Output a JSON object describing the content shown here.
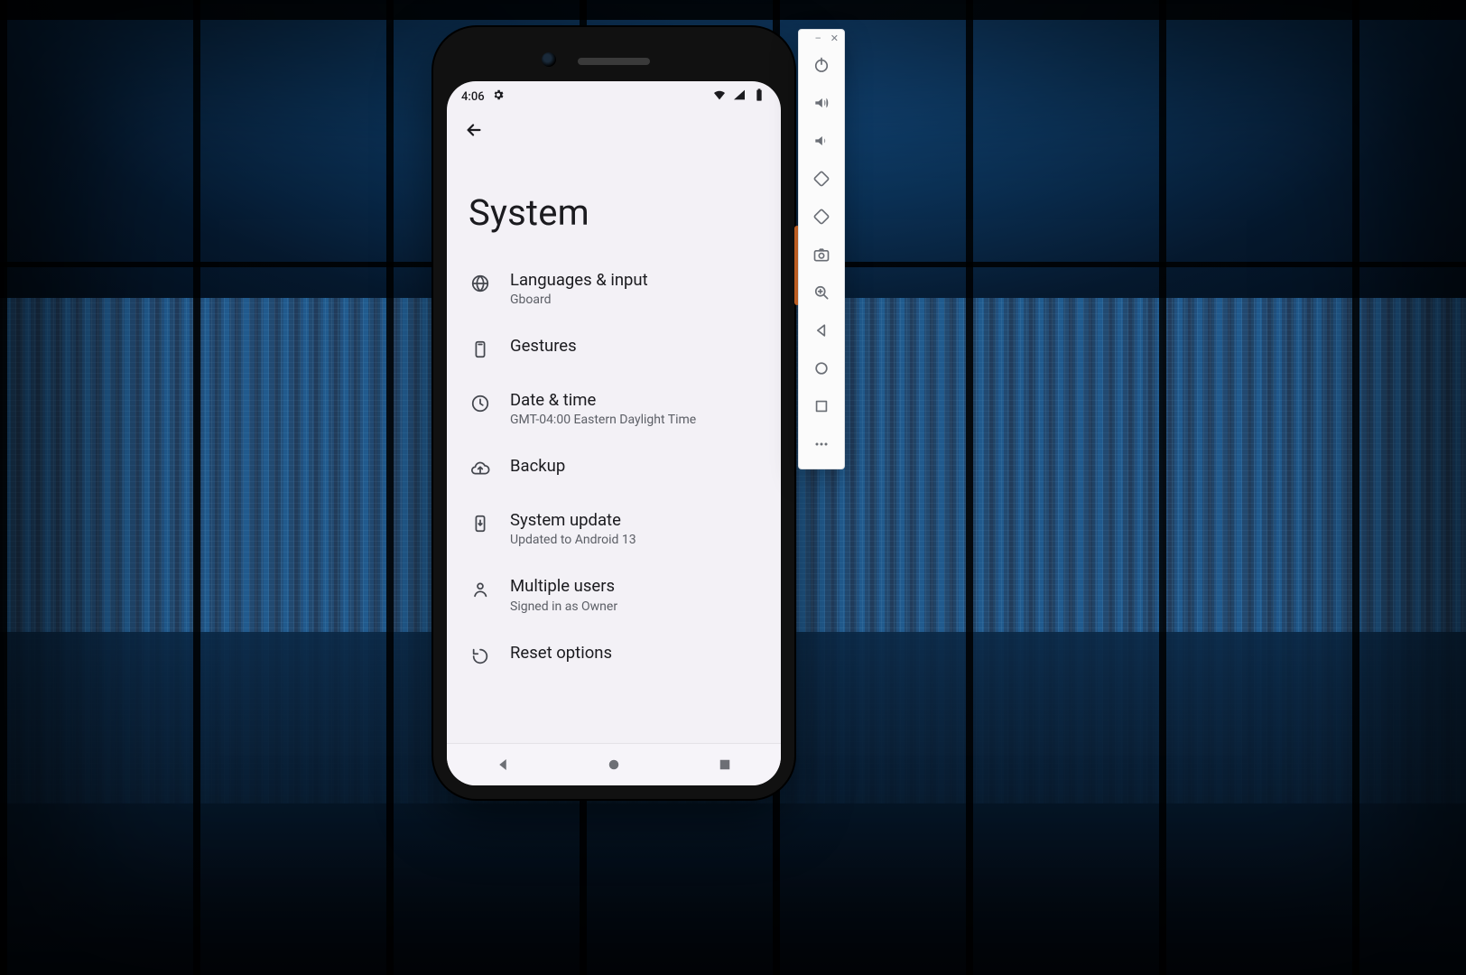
{
  "status_bar": {
    "time": "4:06"
  },
  "page": {
    "title": "System"
  },
  "items": [
    {
      "title": "Languages & input",
      "subtitle": "Gboard"
    },
    {
      "title": "Gestures",
      "subtitle": ""
    },
    {
      "title": "Date & time",
      "subtitle": "GMT-04:00 Eastern Daylight Time"
    },
    {
      "title": "Backup",
      "subtitle": ""
    },
    {
      "title": "System update",
      "subtitle": "Updated to Android 13"
    },
    {
      "title": "Multiple users",
      "subtitle": "Signed in as Owner"
    },
    {
      "title": "Reset options",
      "subtitle": ""
    }
  ],
  "emulator": {
    "window": {
      "minimize": "–",
      "close": "✕"
    },
    "buttons": [
      "power",
      "volume-up",
      "volume-down",
      "rotate-left",
      "rotate-right",
      "screenshot",
      "zoom",
      "back",
      "home",
      "overview",
      "more"
    ]
  }
}
